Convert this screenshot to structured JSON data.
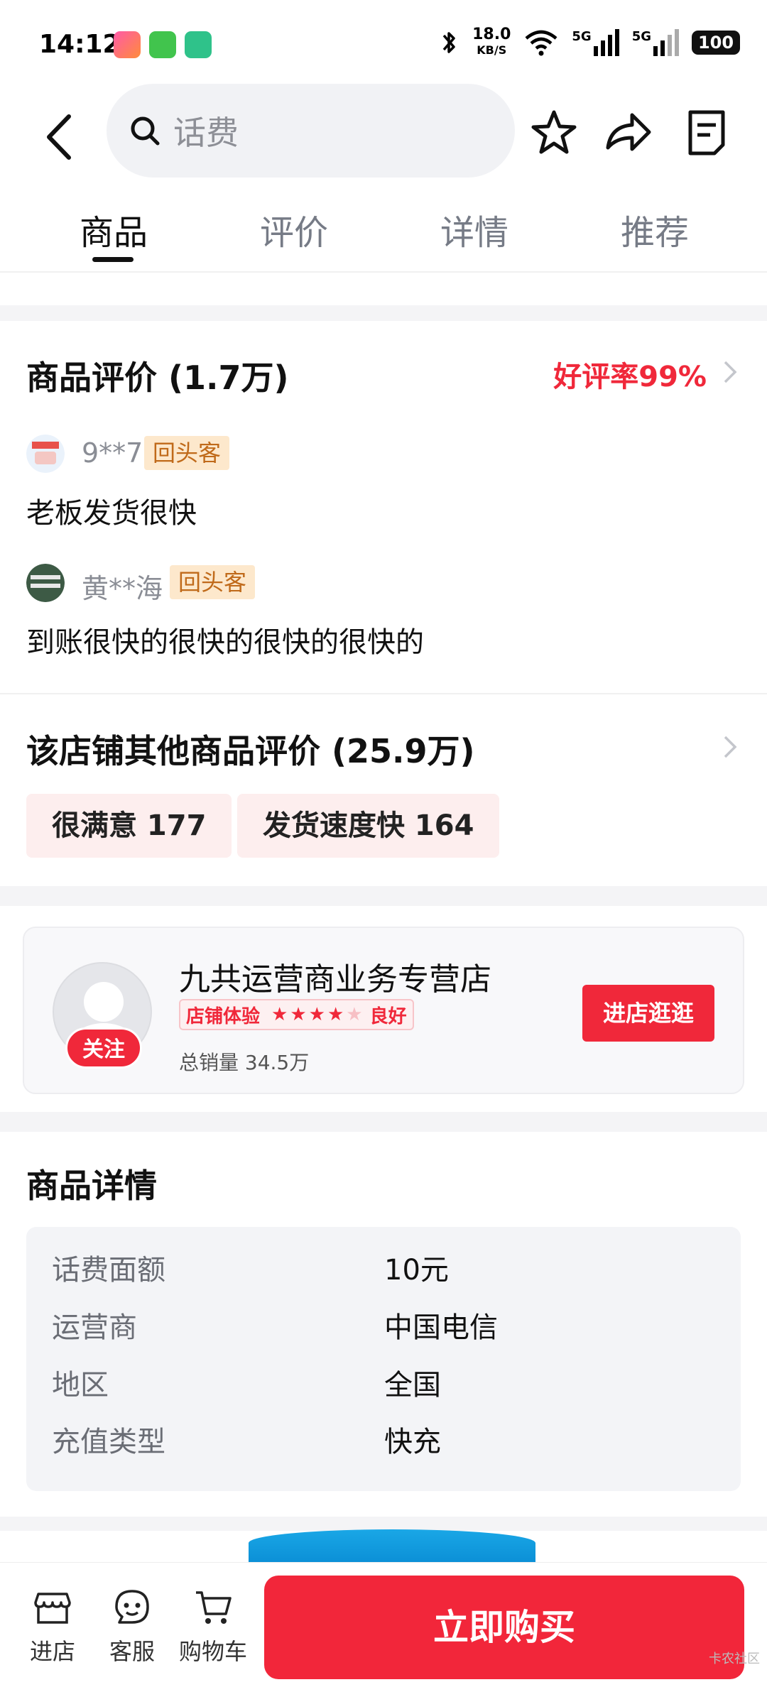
{
  "status_bar": {
    "time": "14:12",
    "net_speed": "18.0",
    "net_unit": "KB/S",
    "signal_1": "5G",
    "signal_2": "5G",
    "battery": "100"
  },
  "header": {
    "search_text": "话费"
  },
  "tabs": [
    {
      "label": "商品",
      "active": true
    },
    {
      "label": "评价",
      "active": false
    },
    {
      "label": "详情",
      "active": false
    },
    {
      "label": "推荐",
      "active": false
    }
  ],
  "reviews": {
    "title": "商品评价 (1.7万)",
    "good_rate": "好评率99%",
    "items": [
      {
        "user": "9**7",
        "badge": "回头客",
        "text": "老板发货很快"
      },
      {
        "user": "黄**海",
        "badge": "回头客",
        "text": "到账很快的很快的很快的很快的"
      }
    ]
  },
  "other_reviews": {
    "title": "该店铺其他商品评价 (25.9万)",
    "tags": [
      "很满意 177",
      "发货速度快 164"
    ]
  },
  "shop": {
    "name": "九共运营商业务专营店",
    "experience_label": "店铺体验",
    "rating_stars": 4,
    "rating_max": 5,
    "rating_text": "良好",
    "sales": "总销量 34.5万",
    "follow_label": "关注",
    "enter_label": "进店逛逛"
  },
  "details": {
    "title": "商品详情",
    "rows": [
      {
        "label": "话费面额",
        "value": "10元"
      },
      {
        "label": "运营商",
        "value": "中国电信"
      },
      {
        "label": "地区",
        "value": "全国"
      },
      {
        "label": "充值类型",
        "value": "快充"
      }
    ]
  },
  "bottom_bar": {
    "shop_label": "进店",
    "service_label": "客服",
    "cart_label": "购物车",
    "buy_label": "立即购买"
  },
  "watermark": "卡农社区",
  "colors": {
    "accent": "#f0283a",
    "badge_bg": "#fde8cc",
    "badge_text": "#c06a1a"
  }
}
